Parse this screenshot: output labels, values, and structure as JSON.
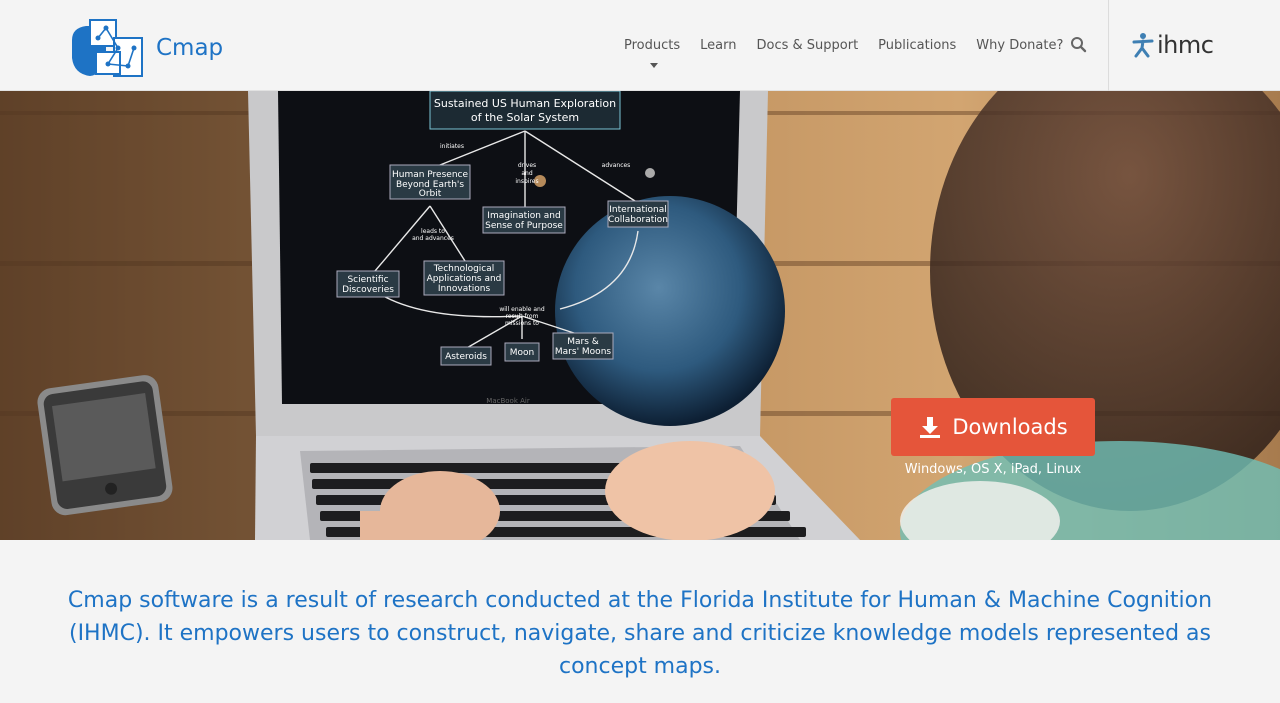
{
  "brand": {
    "name": "Cmap",
    "partner": "ihmc"
  },
  "nav": {
    "items": [
      {
        "label": "Products",
        "has_dropdown": true
      },
      {
        "label": "Learn"
      },
      {
        "label": "Docs & Support"
      },
      {
        "label": "Publications"
      },
      {
        "label": "Why Donate?"
      }
    ],
    "search_icon": "search-icon"
  },
  "hero": {
    "laptop_label": "MacBook Air",
    "concept_map": {
      "root": "Sustained US Human Exploration of the Solar System",
      "nodes": [
        "Human Presence Beyond Earth's Orbit",
        "Imagination and Sense of Purpose",
        "International Collaboration",
        "Scientific Discoveries",
        "Technological Applications and Innovations",
        "Asteroids",
        "Moon",
        "Mars & Mars' Moons"
      ],
      "links": [
        "initiates",
        "drives and inspires",
        "advances",
        "leads to and advances",
        "will enable and result from missions to"
      ]
    },
    "download": {
      "label": "Downloads",
      "platforms": "Windows, OS X, iPad, Linux"
    }
  },
  "intro_text": "Cmap software is a result of research conducted at the Florida Institute for Human & Machine Cognition (IHMC). It empowers users to construct, navigate, share and criticize knowledge models represented as concept maps.",
  "colors": {
    "brand_blue": "#1e73c5",
    "download_orange": "#e5553a",
    "background": "#f4f4f4"
  }
}
